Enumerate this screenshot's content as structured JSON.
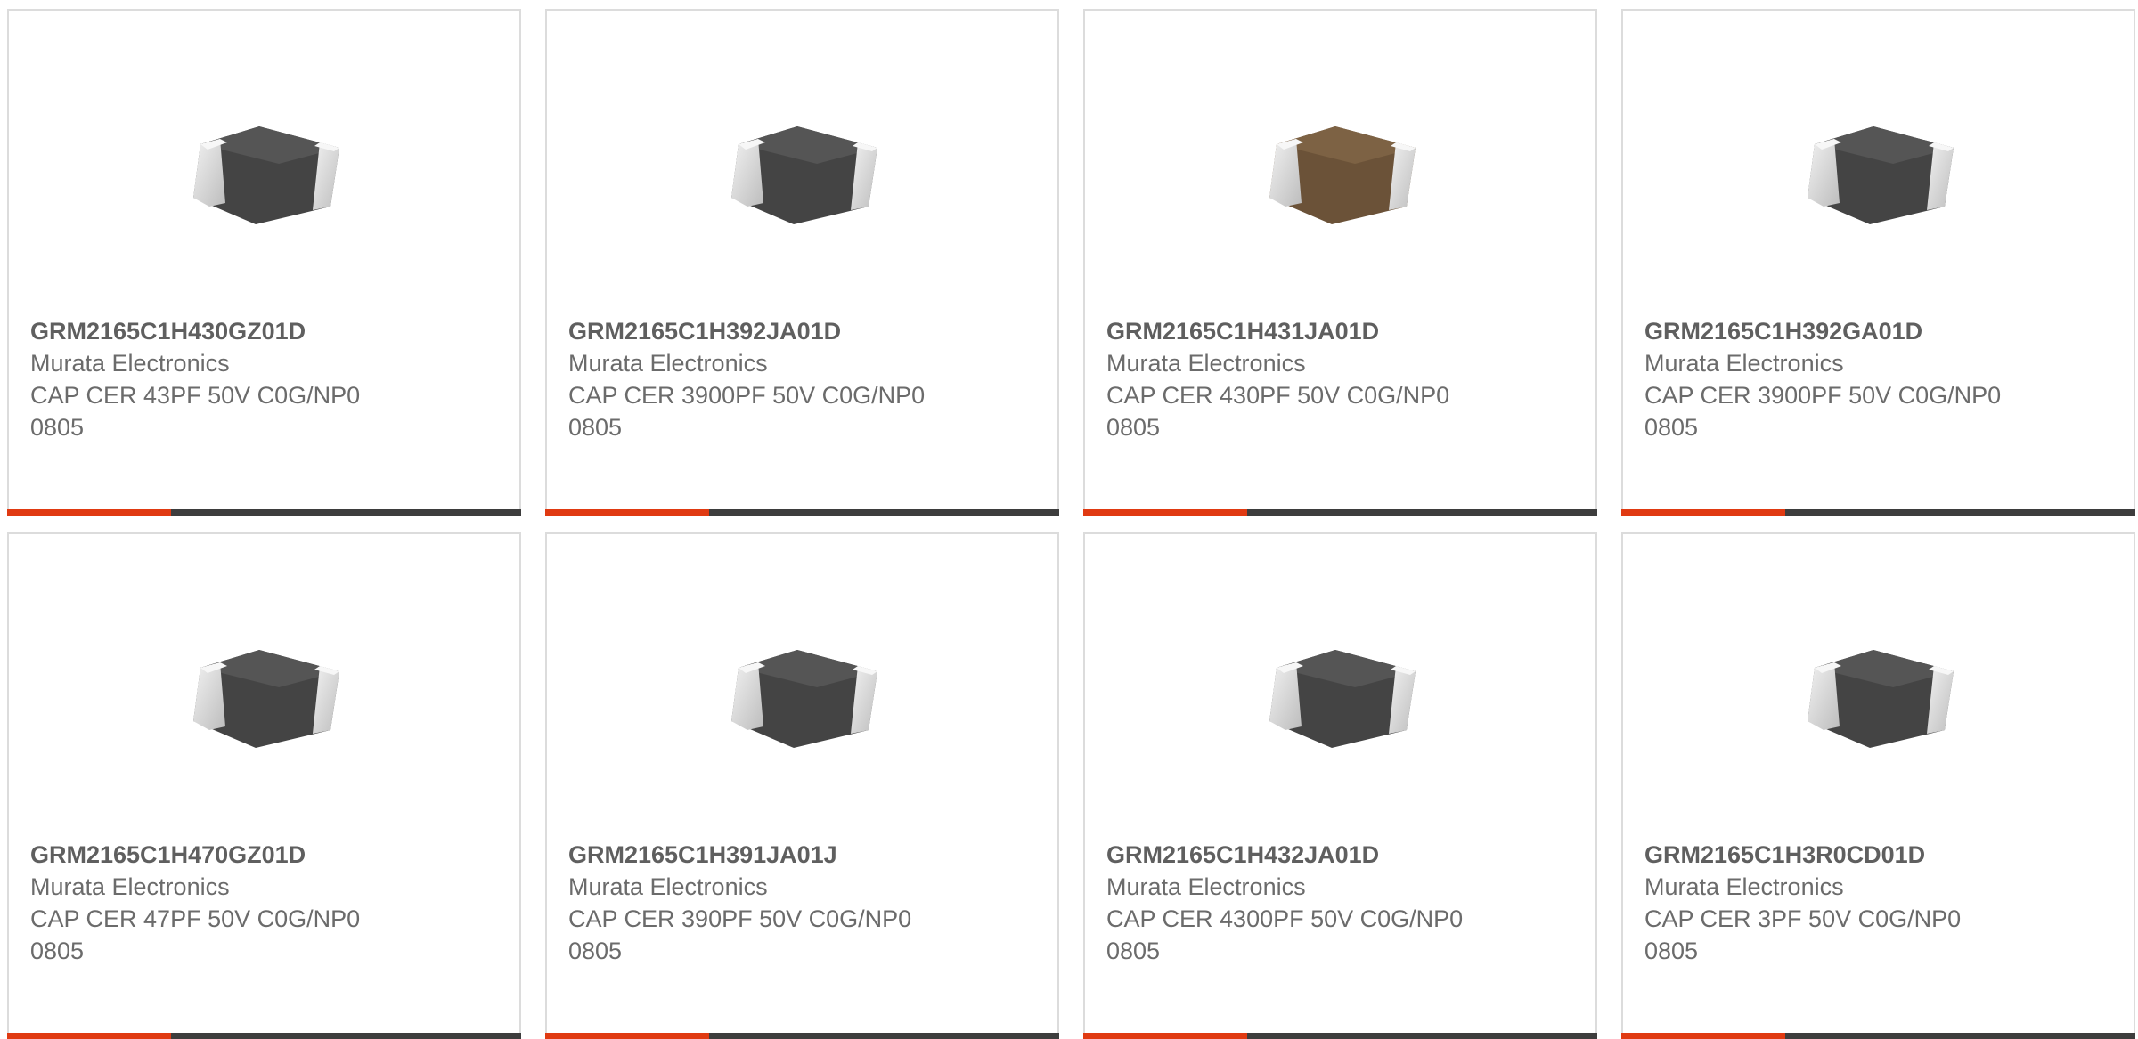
{
  "colors": {
    "accent": "#e03a12",
    "bar": "#3d3d3d",
    "border": "#dcdcdc",
    "text": "#6b6b6b"
  },
  "products": [
    {
      "part_number": "GRM2165C1H430GZ01D",
      "manufacturer": "Murata Electronics",
      "description": "CAP CER 43PF 50V C0G/NP0",
      "package": "0805",
      "image_icon": "gray-mlcc-chip-image"
    },
    {
      "part_number": "GRM2165C1H392JA01D",
      "manufacturer": "Murata Electronics",
      "description": "CAP CER 3900PF 50V C0G/NP0",
      "package": "0805",
      "image_icon": "gray-mlcc-chip-image"
    },
    {
      "part_number": "GRM2165C1H431JA01D",
      "manufacturer": "Murata Electronics",
      "description": "CAP CER 430PF 50V C0G/NP0",
      "package": "0805",
      "image_icon": "brown-mlcc-chip-image"
    },
    {
      "part_number": "GRM2165C1H392GA01D",
      "manufacturer": "Murata Electronics",
      "description": "CAP CER 3900PF 50V C0G/NP0",
      "package": "0805",
      "image_icon": "gray-mlcc-chip-image"
    },
    {
      "part_number": "GRM2165C1H470GZ01D",
      "manufacturer": "Murata Electronics",
      "description": "CAP CER 47PF 50V C0G/NP0",
      "package": "0805",
      "image_icon": "gray-mlcc-chip-image"
    },
    {
      "part_number": "GRM2165C1H391JA01J",
      "manufacturer": "Murata Electronics",
      "description": "CAP CER 390PF 50V C0G/NP0",
      "package": "0805",
      "image_icon": "gray-mlcc-chip-image"
    },
    {
      "part_number": "GRM2165C1H432JA01D",
      "manufacturer": "Murata Electronics",
      "description": "CAP CER 4300PF 50V C0G/NP0",
      "package": "0805",
      "image_icon": "gray-mlcc-chip-image"
    },
    {
      "part_number": "GRM2165C1H3R0CD01D",
      "manufacturer": "Murata Electronics",
      "description": "CAP CER 3PF 50V C0G/NP0",
      "package": "0805",
      "image_icon": "gray-mlcc-chip-image"
    }
  ]
}
